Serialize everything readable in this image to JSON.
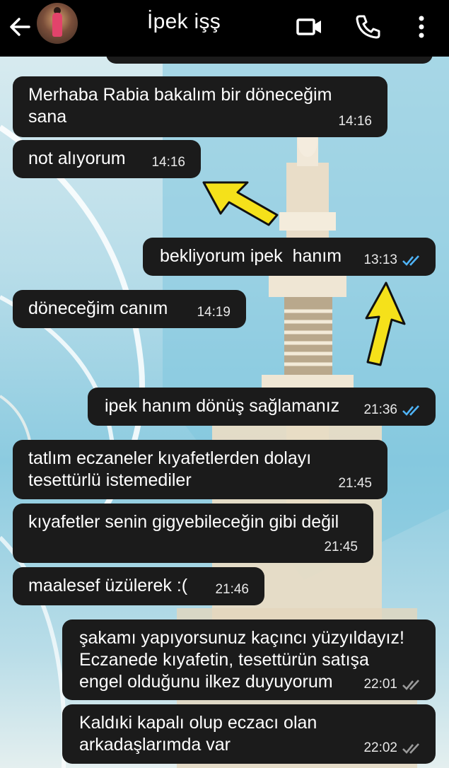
{
  "header": {
    "contact_name": "İpek işş",
    "icons": [
      "back-arrow-icon",
      "avatar",
      "video-call-icon",
      "phone-icon",
      "more-vert-icon"
    ],
    "background_color": "#000000"
  },
  "messages": [
    {
      "direction": "incoming",
      "text": "Merhaba Rabia bakalım bir döneceğim\nsana",
      "time": "14:16"
    },
    {
      "direction": "incoming",
      "text": "not alıyorum",
      "time": "14:16"
    },
    {
      "direction": "outgoing",
      "text": "bekliyorum ipek  hanım",
      "time": "13:13",
      "status": "read"
    },
    {
      "direction": "incoming",
      "text": "döneceğim canım",
      "time": "14:19"
    },
    {
      "direction": "outgoing",
      "text": "ipek hanım dönüş sağlamanız",
      "time": "21:36",
      "status": "read"
    },
    {
      "direction": "incoming",
      "text": "tatlım eczaneler kıyafetlerden dolayı\ntesettürlü istemediler",
      "time": "21:45"
    },
    {
      "direction": "incoming",
      "text": "kıyafetler senin gigyebileceğin gibi değil",
      "time": "21:45"
    },
    {
      "direction": "incoming",
      "text": "maalesef üzülerek :(",
      "time": "21:46"
    },
    {
      "direction": "outgoing",
      "text": "şakamı yapıyorsunuz kaçıncı yüzyıldayız!\nEczanede kıyafetin, tesettürün satışa\nengel olduğunu ilkez duyuyorum",
      "time": "22:01",
      "status": "delivered"
    },
    {
      "direction": "outgoing",
      "text": "Kaldıki kapalı olup eczacı olan\narkadaşlarımda var",
      "time": "22:02",
      "status": "delivered"
    }
  ],
  "colors": {
    "bubble": "#1b1b1b",
    "read_tick": "#4fb3f6",
    "delivered_tick": "#9a9a9a",
    "annotation_arrow": "#f5e11a"
  }
}
